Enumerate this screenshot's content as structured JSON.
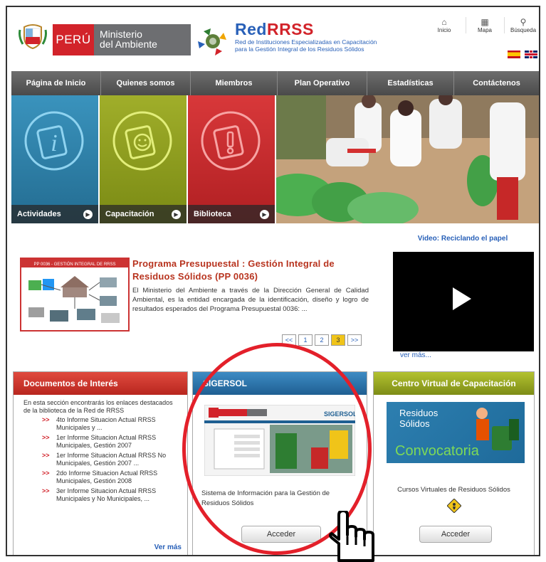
{
  "header": {
    "peru_label": "PERÚ",
    "ministry_label_1": "Ministerio",
    "ministry_label_2": "del Ambiente",
    "rrss_red": "Red",
    "rrss_rrss": "RRSS",
    "rrss_subtitle_1": "Red de Instituciones Especializadas en Capacitación",
    "rrss_subtitle_2": "para la Gestión Integral de los Residuos Sólidos",
    "tools": [
      {
        "label": "Inicio",
        "icon": "home-icon"
      },
      {
        "label": "Mapa",
        "icon": "map-icon"
      },
      {
        "label": "Búsqueda",
        "icon": "search-icon"
      }
    ],
    "languages": [
      "es-flag-icon",
      "uk-flag-icon"
    ]
  },
  "nav": {
    "items": [
      {
        "label": "Página de Inicio"
      },
      {
        "label": "Quienes somos"
      },
      {
        "label": "Miembros"
      },
      {
        "label": "Plan Operativo"
      },
      {
        "label": "Estadísticas"
      },
      {
        "label": "Contáctenos"
      }
    ]
  },
  "tiles": [
    {
      "label": "Actividades",
      "color": "#2c7fa8",
      "icon": "info-icon"
    },
    {
      "label": "Capacitación",
      "color": "#8a9a1e",
      "icon": "smiley-icon"
    },
    {
      "label": "Biblioteca",
      "color": "#c8292b",
      "icon": "exclamation-icon"
    }
  ],
  "news": {
    "image_caption": "PP 0036 - GESTIÓN INTEGRAL DE RRSS",
    "title": "Programa Presupuestal : Gestión Integral de Residuos Sólidos (PP 0036)",
    "body": "El Ministerio del Ambiente a través de la Dirección General de Calidad Ambiental, es la entidad encargada de la identificación, diseño y logro de resultados esperados del Programa Presupuestal 0036: ...",
    "pager": [
      "<<",
      "1",
      "2",
      "3",
      ">>"
    ],
    "active_page": "3"
  },
  "video": {
    "title": "Video: Reciclando el papel",
    "more": "ver más..."
  },
  "documents": {
    "title": "Documentos de Interés",
    "intro": "En esta sección encontrarás los enlaces destacados de la biblioteca de la Red de RRSS",
    "items": [
      "4to Informe Situacion Actual RRSS Municipales y ...",
      "1er Informe Situacion Actual RRSS Municipales, Gestión 2007",
      "1er Informe Situacion Actual RRSS No Municipales, Gestión 2007 ...",
      "2do Informe Situacion Actual RRSS Municipales, Gestión 2008",
      "3er Informe Situacion Actual RRSS Municipales y No Municipales, ..."
    ],
    "bullet": ">>",
    "more": "Ver más"
  },
  "sigersol": {
    "title": "SIGERSOL",
    "description": "Sistema de Información para la Gestión de Residuos Sólidos",
    "button": "Acceder",
    "screenshot_brand": "SIGERSOL"
  },
  "centro": {
    "title": "Centro Virtual de Capacitación",
    "banner_1": "Residuos",
    "banner_2": "Sólidos",
    "banner_3": "Convocatoria",
    "description": "Cursos Virtuales de Residuos Sólidos",
    "button": "Acceder"
  }
}
